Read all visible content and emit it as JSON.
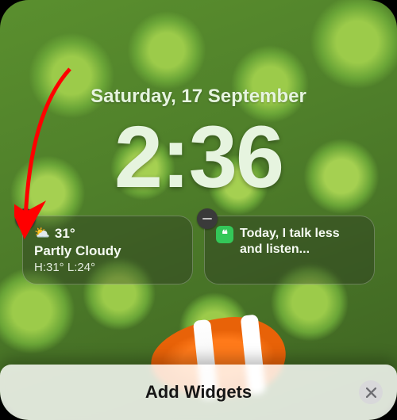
{
  "lockscreen": {
    "date": "Saturday, 17 September",
    "time": "2:36"
  },
  "widgets": [
    {
      "kind": "weather",
      "icon_name": "sun-cloud-icon",
      "icon_glyph": "⛅",
      "temp": "31°",
      "condition": "Partly Cloudy",
      "hi_lo": "H:31° L:24°"
    },
    {
      "kind": "quote",
      "icon_name": "quote-app-icon",
      "icon_glyph": "❝",
      "text": "Today, I talk less and listen..."
    }
  ],
  "sheet": {
    "title": "Add Widgets"
  },
  "annotation": {
    "arrow_color": "#ff0000"
  }
}
